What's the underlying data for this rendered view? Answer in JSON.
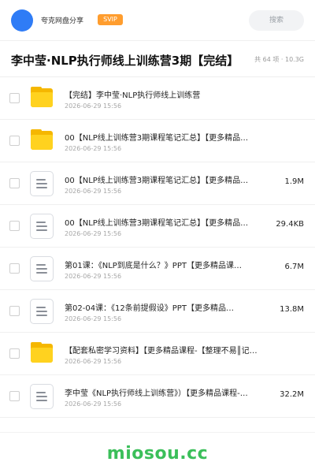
{
  "header": {
    "user_name": "夸克网盘分享",
    "badge": "SVIP",
    "search_placeholder": "搜索"
  },
  "title": "李中莹·NLP执行师线上训练营3期【完结】",
  "meta": "共 64 项 · 10.3G",
  "items": [
    {
      "type": "folder",
      "name": "【完结】李中莹·NLP执行师线上训练营",
      "date": "2026-06-29 15:56",
      "size": ""
    },
    {
      "type": "folder",
      "name": "00【NLP线上训练营3期课程笔记汇总】【更多精品…",
      "date": "2026-06-29 15:56",
      "size": ""
    },
    {
      "type": "file",
      "name": "00【NLP线上训练营3期课程笔记汇总】【更多精品…",
      "date": "2026-06-29 15:56",
      "size": "1.9M"
    },
    {
      "type": "file",
      "name": "00【NLP线上训练营3期课程笔记汇总】【更多精品…",
      "date": "2026-06-29 15:56",
      "size": "29.4KB"
    },
    {
      "type": "file",
      "name": "第01课：《NLP到底是什么？》PPT【更多精品课…",
      "date": "2026-06-29 15:56",
      "size": "6.7M"
    },
    {
      "type": "file",
      "name": "第02-04课：《12条前提假设》PPT【更多精品…",
      "date": "2026-06-29 15:56",
      "size": "13.8M"
    },
    {
      "type": "folder",
      "name": "【配套私密学习资料】【更多精品课程-【整理不易║记…",
      "date": "2026-06-29 15:56",
      "size": ""
    },
    {
      "type": "file",
      "name": "李中莹《NLP执行师线上训练营》）【更多精品课程-…",
      "date": "2026-06-29 15:56",
      "size": "32.2M"
    }
  ],
  "watermark": "miosou.cc",
  "colors": {
    "accent": "#2f7cf6",
    "folder": "#ffd21f",
    "badge": "#ff9d2e",
    "watermark": "#3bbf5a"
  }
}
